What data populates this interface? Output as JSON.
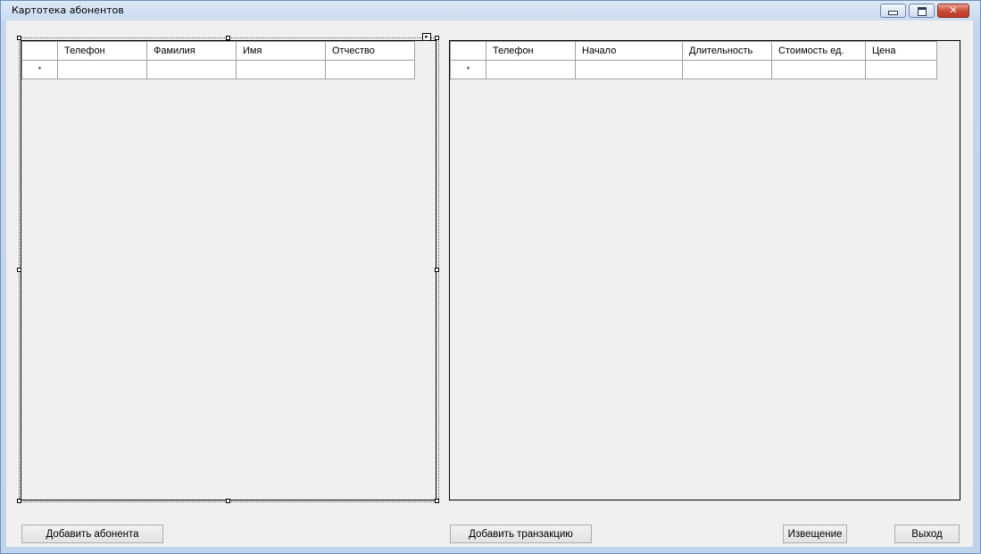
{
  "window": {
    "title": "Картотека абонентов"
  },
  "subscribers_grid": {
    "columns": [
      "Телефон",
      "Фамилия",
      "Имя",
      "Отчество"
    ],
    "new_row_marker": "*"
  },
  "transactions_grid": {
    "columns": [
      "Телефон",
      "Начало",
      "Длительность",
      "Стоимость ед.",
      "Цена"
    ],
    "new_row_marker": "*"
  },
  "buttons": {
    "add_subscriber": "Добавить абонента",
    "add_transaction": "Добавить транзакцию",
    "notice": "Извещение",
    "exit": "Выход"
  },
  "icons": {
    "minimize": "minimize-icon",
    "maximize": "maximize-icon",
    "close": "close-icon",
    "smart_tag": "smart-tag-arrow-icon"
  }
}
